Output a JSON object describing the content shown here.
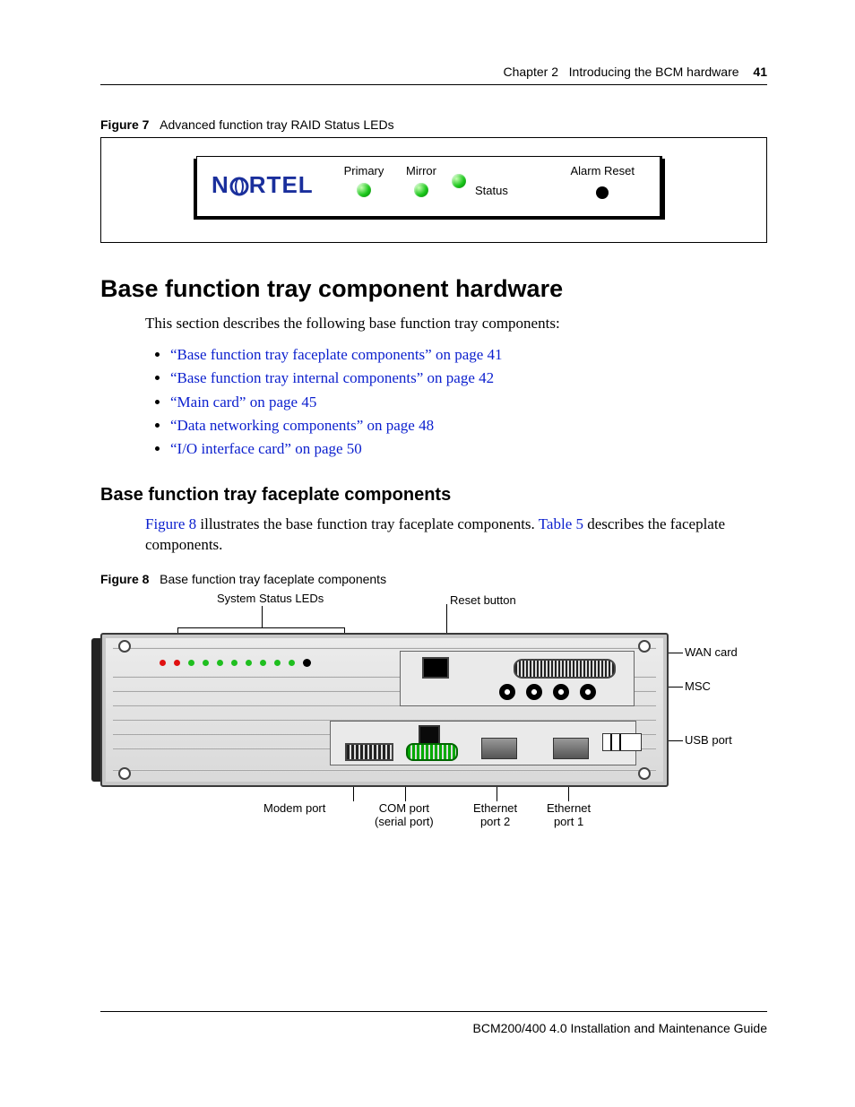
{
  "header": {
    "chapter": "Chapter 2",
    "title": "Introducing the BCM hardware",
    "page_number": "41"
  },
  "figure7": {
    "caption_label": "Figure 7",
    "caption_text": "Advanced function tray RAID Status LEDs",
    "logo_text": "N RTEL",
    "primary_label": "Primary",
    "mirror_label": "Mirror",
    "status_label": "Status",
    "alarm_label": "Alarm Reset"
  },
  "section": {
    "heading": "Base function tray component hardware",
    "intro": "This section describes the following base function tray components:",
    "links": [
      "“Base function tray faceplate components” on page 41",
      "“Base function tray internal components” on page 42",
      "“Main card” on page 45",
      "“Data networking components” on page 48",
      "“I/O interface card” on page 50"
    ],
    "subheading": "Base function tray faceplate components",
    "subpara_pre": "Figure 8",
    "subpara_mid": " illustrates the base function tray faceplate components. ",
    "subpara_link2": "Table 5",
    "subpara_post": " describes the faceplate components."
  },
  "figure8": {
    "caption_label": "Figure 8",
    "caption_text": "Base function tray faceplate components",
    "callouts": {
      "system_status_leds": "System Status LEDs",
      "reset_button": "Reset button",
      "wan_card": "WAN card",
      "msc": "MSC",
      "usb_port": "USB port",
      "modem_port": "Modem port",
      "com_port_l1": "COM port",
      "com_port_l2": "(serial port)",
      "eth2_l1": "Ethernet",
      "eth2_l2": "port 2",
      "eth1_l1": "Ethernet",
      "eth1_l2": "port 1"
    }
  },
  "footer": {
    "text": "BCM200/400 4.0 Installation and Maintenance Guide"
  }
}
